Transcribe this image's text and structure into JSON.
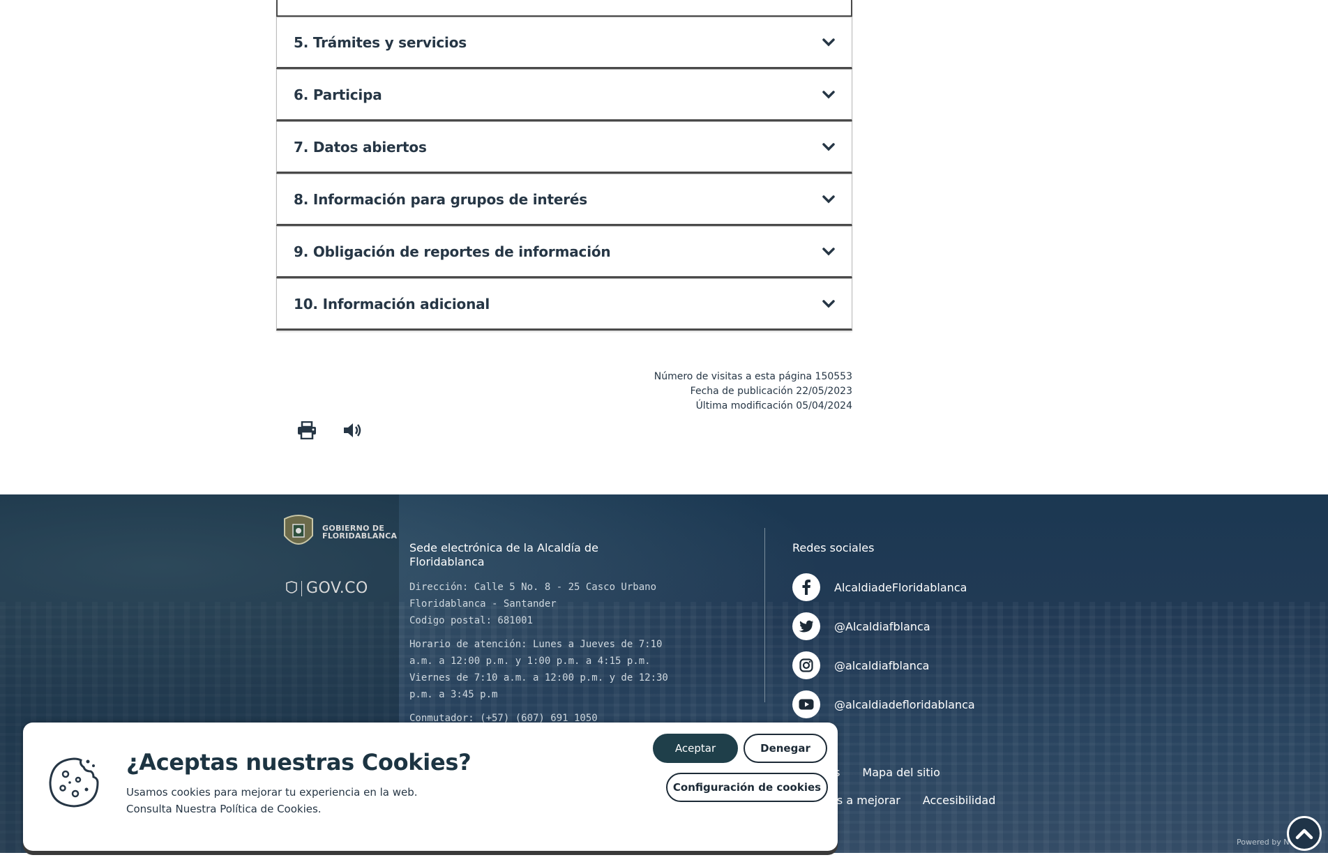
{
  "accordion": {
    "items": [
      {
        "label": "5. Trámites y servicios"
      },
      {
        "label": "6. Participa"
      },
      {
        "label": "7. Datos abiertos"
      },
      {
        "label": "8. Información para grupos de interés"
      },
      {
        "label": "9. Obligación de reportes de información"
      },
      {
        "label": "10. Información adicional"
      }
    ]
  },
  "meta": {
    "visits": "Número de visitas a esta página 150553",
    "published": "Fecha de publicación 22/05/2023",
    "modified": "Última modificación 05/04/2024"
  },
  "tools": {
    "print_icon": "print-icon",
    "audio_icon": "volume-icon"
  },
  "footer": {
    "gob_logo_line1": "GOBIERNO DE",
    "gob_logo_line2": "FLORIDABLANCA",
    "govco": "GOV.CO",
    "sede_title": "Sede electrónica de la Alcaldía de Floridablanca",
    "address": "Dirección: Calle 5 No. 8 - 25 Casco Urbano Floridablanca - Santander",
    "postal": "Codigo postal: 681001",
    "hours": "Horario de atención: Lunes a Jueves de 7:10 a.m. a 12:00 p.m. y 1:00 p.m. a 4:15 p.m. Viernes de 7:10 a.m. a 12:00 p.m. y de 12:30 p.m. a 3:45 p.m",
    "phone": "Conmutador: (+57) (607) 691 1050",
    "social_title": "Redes sociales",
    "social": [
      {
        "icon": "facebook-icon",
        "label": "AlcaldiadeFloridablanca"
      },
      {
        "icon": "twitter-icon",
        "label": "@Alcaldiafblanca"
      },
      {
        "icon": "instagram-icon",
        "label": "@alcaldiafblanca"
      },
      {
        "icon": "youtube-icon",
        "label": "@alcaldiadefloridablanca"
      }
    ],
    "links_row1_a": "tas",
    "links_row1_b": "Mapa del sitio",
    "links_row2_a": "nos a mejorar",
    "links_row2_b": "Accesibilidad",
    "powered": "Powered by N"
  },
  "cookie": {
    "title": "¿Aceptas nuestras Cookies?",
    "text_line1": "Usamos cookies para mejorar tu experiencia en la web.",
    "text_line2": "Consulta Nuestra Política de Cookies.",
    "accept": "Aceptar",
    "deny": "Denegar",
    "config": "Configuración de cookies"
  },
  "colors": {
    "brand_dark": "#1f3f4a",
    "text": "#263645",
    "footer_bg": "#223a55"
  }
}
